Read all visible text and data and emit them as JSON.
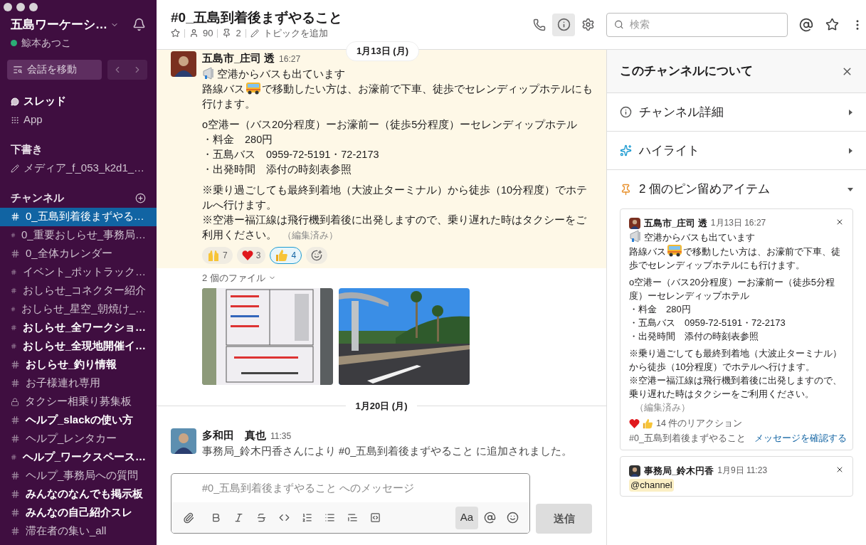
{
  "sidebar": {
    "workspace": "五島ワーケーシ…",
    "user": "鯨本あつこ",
    "online": true,
    "jump": "会話を移動",
    "threads": "スレッド",
    "apps": "App",
    "drafts_heading": "下書き",
    "drafts": [
      "メディア_f_053_k2d1_…"
    ],
    "channels_heading": "チャンネル",
    "channels": [
      {
        "name": "0_五島到着後まずやる…",
        "kind": "public",
        "unread": false,
        "selected": true
      },
      {
        "name": "0_重要おしらせ_事務局…",
        "kind": "public",
        "unread": false,
        "selected": false
      },
      {
        "name": "0_全体カレンダー",
        "kind": "public",
        "unread": false,
        "selected": false
      },
      {
        "name": "イベント_ポットラック…",
        "kind": "public",
        "unread": false,
        "selected": false
      },
      {
        "name": "おしらせ_コネクター紹介",
        "kind": "public",
        "unread": false,
        "selected": false
      },
      {
        "name": "おしらせ_星空_朝焼け_…",
        "kind": "public",
        "unread": false,
        "selected": false
      },
      {
        "name": "おしらせ_全ワークショ…",
        "kind": "public",
        "unread": true,
        "selected": false
      },
      {
        "name": "おしらせ_全現地開催イ…",
        "kind": "public",
        "unread": true,
        "selected": false
      },
      {
        "name": "おしらせ_釣り情報",
        "kind": "public",
        "unread": true,
        "selected": false
      },
      {
        "name": "お子様連れ専用",
        "kind": "public",
        "unread": false,
        "selected": false
      },
      {
        "name": "タクシー相乗り募集板",
        "kind": "private",
        "unread": false,
        "selected": false
      },
      {
        "name": "ヘルプ_slackの使い方",
        "kind": "public",
        "unread": true,
        "selected": false
      },
      {
        "name": "ヘルプ_レンタカー",
        "kind": "public",
        "unread": false,
        "selected": false
      },
      {
        "name": "ヘルプ_ワークスペース…",
        "kind": "public",
        "unread": true,
        "selected": false
      },
      {
        "name": "ヘルプ_事務局への質問",
        "kind": "public",
        "unread": false,
        "selected": false
      },
      {
        "name": "みんなのなんでも掲示板",
        "kind": "public",
        "unread": true,
        "selected": false
      },
      {
        "name": "みんなの自己紹介スレ",
        "kind": "public",
        "unread": true,
        "selected": false
      },
      {
        "name": "滞在者の集い_all",
        "kind": "public",
        "unread": false,
        "selected": false
      }
    ]
  },
  "channel": {
    "title": "#0_五島到着後まずやること",
    "members": "90",
    "pins": "2",
    "topic": "トピックを追加",
    "details_open": true
  },
  "search": {
    "placeholder": "検索"
  },
  "sticky_date": "1月13日 (月)",
  "message": {
    "author": "五島市_庄司 透",
    "time": "16:27",
    "highlighted": true,
    "paragraphs": [
      [
        [
          {
            "kind": "megaphone"
          },
          {
            "kind": "text",
            "text": "空港からバスも出ています"
          }
        ],
        [
          {
            "kind": "text",
            "text": "路線バス"
          },
          {
            "kind": "bus"
          },
          {
            "kind": "text",
            "text": "で移動したい方は、お濠前で下車、徒歩でセレンディップホテルにも行けます。"
          }
        ]
      ],
      [
        [
          {
            "kind": "text",
            "text": "o空港ー（バス20分程度）ーお濠前ー（徒歩5分程度）ーセレンディップホテル"
          }
        ],
        [
          {
            "kind": "text",
            "text": "・料金　280円"
          }
        ],
        [
          {
            "kind": "text",
            "text": "・五島バス　0959-72-5191・72-2173"
          }
        ],
        [
          {
            "kind": "text",
            "text": "・出発時間　添付の時刻表参照"
          }
        ]
      ],
      [
        [
          {
            "kind": "text",
            "text": "※乗り過ごしても最終到着地（大波止ターミナル）から徒歩（10分程度）でホテルへ行けます。"
          }
        ],
        [
          {
            "kind": "text",
            "text": "※空港ー福江線は飛行機到着後に出発しますので、乗り遅れた時はタクシーをご利用ください。"
          },
          {
            "kind": "edited",
            "text": "（編集済み）"
          }
        ]
      ]
    ],
    "reactions": [
      {
        "count": "7",
        "selected": false
      },
      {
        "count": "3",
        "selected": false
      },
      {
        "count": "4",
        "selected": true
      }
    ],
    "files_label": "2 個のファイル"
  },
  "date_divider": "1月20日 (月)",
  "message2": {
    "author": "多和田　真也",
    "time": "11:35",
    "text": "事務局_鈴木円香さんにより #0_五島到着後まずやること に追加されました。"
  },
  "composer": {
    "placeholder": "#0_五島到着後まずやること へのメッセージ",
    "format_label": "Aa",
    "format_active": true,
    "send": "送信"
  },
  "details": {
    "title": "このチャンネルについて",
    "sections": [
      {
        "label": "チャンネル詳細",
        "kind": "info",
        "expanded": false
      },
      {
        "label": "ハイライト",
        "kind": "highlights",
        "expanded": false
      },
      {
        "label": "2 個のピン留めアイテム",
        "kind": "pins",
        "expanded": true
      }
    ],
    "pins": [
      {
        "author": "五島市_庄司 透",
        "time": "1月13日 16:27",
        "paragraphs": [
          [
            [
              {
                "kind": "megaphone"
              },
              {
                "kind": "text",
                "text": "空港からバスも出ています"
              }
            ],
            [
              {
                "kind": "text",
                "text": "路線バス"
              },
              {
                "kind": "bus"
              },
              {
                "kind": "text",
                "text": "で移動したい方は、お濠前で下車、徒歩でセレンディップホテルにも行けます。"
              }
            ]
          ],
          [
            [
              {
                "kind": "text",
                "text": "o空港ー（バス20分程度）ーお濠前ー（徒歩5分程度）ーセレンディップホテル"
              }
            ],
            [
              {
                "kind": "text",
                "text": "・料金　280円"
              }
            ],
            [
              {
                "kind": "text",
                "text": "・五島バス　0959-72-5191・72-2173"
              }
            ],
            [
              {
                "kind": "text",
                "text": "・出発時間　添付の時刻表参照"
              }
            ]
          ],
          [
            [
              {
                "kind": "text",
                "text": "※乗り過ごしても最終到着地（大波止ターミナル）から徒歩（10分程度）でホテルへ行けます。"
              }
            ],
            [
              {
                "kind": "text",
                "text": "※空港ー福江線は飛行機到着後に出発しますので、乗り遅れた時はタクシーをご利用ください。"
              },
              {
                "kind": "edited",
                "text": "（編集済み）"
              }
            ]
          ]
        ],
        "reactions": "14 件のリアクション",
        "channel": "#0_五島到着後まずやること",
        "link": "メッセージを確認する"
      },
      {
        "author": "事務局_鈴木円香",
        "time": "1月9日 11:23",
        "mention": "@channel"
      }
    ]
  }
}
